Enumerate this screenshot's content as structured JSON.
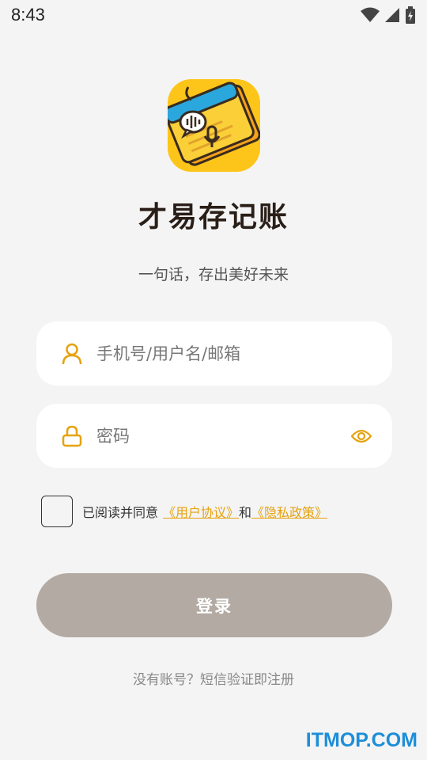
{
  "status_bar": {
    "time": "8:43",
    "icons": [
      "wifi-icon",
      "signal-icon",
      "battery-icon"
    ]
  },
  "app": {
    "title": "才易存记账",
    "slogan": "一句话，存出美好未来",
    "logo_icon": "ledger-voice-icon"
  },
  "form": {
    "username_placeholder": "手机号/用户名/邮箱",
    "username_value": "",
    "password_placeholder": "密码",
    "password_value": "",
    "username_icon": "user-icon",
    "password_icon": "lock-icon",
    "toggle_icon": "eye-icon"
  },
  "agreement": {
    "checked": false,
    "prefix": "已阅读并同意",
    "user_agreement": "《用户协议》",
    "connector": "和",
    "privacy_policy": "《隐私政策》"
  },
  "login_button": "登录",
  "register_link": "没有账号？短信验证即注册",
  "watermark": "ITMOP.COM",
  "colors": {
    "accent": "#e6a20d",
    "button_disabled": "#b2aaa3",
    "background": "#f4f4f4",
    "title": "#2a1f18"
  }
}
